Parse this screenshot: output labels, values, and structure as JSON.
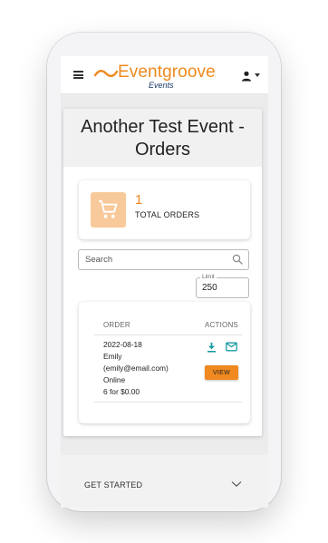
{
  "header": {
    "logo_text": "Eventgroove",
    "logo_subtext": "Events"
  },
  "page": {
    "title_line1": "Another Test Event -",
    "title_line2": "Orders"
  },
  "stats": {
    "total_orders_value": "1",
    "total_orders_label": "TOTAL ORDERS"
  },
  "search": {
    "placeholder": "Search",
    "value": ""
  },
  "limit": {
    "label": "Limit",
    "value": "250"
  },
  "orders_table": {
    "columns": [
      "ORDER",
      "ACTIONS"
    ],
    "rows": [
      {
        "date": "2022-08-18",
        "name": "Emily",
        "email": "(emily@email.com)",
        "channel": "Online",
        "quantity_price": "6 for $0.00",
        "view_label": "VIEW"
      }
    ]
  },
  "footer": {
    "get_started_label": "GET STARTED"
  },
  "colors": {
    "brand_orange": "#f0891f",
    "brand_navy": "#1b3a6b",
    "action_teal": "#1a9ba3",
    "cart_tile": "#f8c99a"
  },
  "icons": [
    "hamburger-icon",
    "logo-wave-icon",
    "account-icon",
    "chevron-down-icon",
    "cart-icon",
    "search-icon",
    "download-icon",
    "mail-icon",
    "expand-chevron-icon"
  ]
}
